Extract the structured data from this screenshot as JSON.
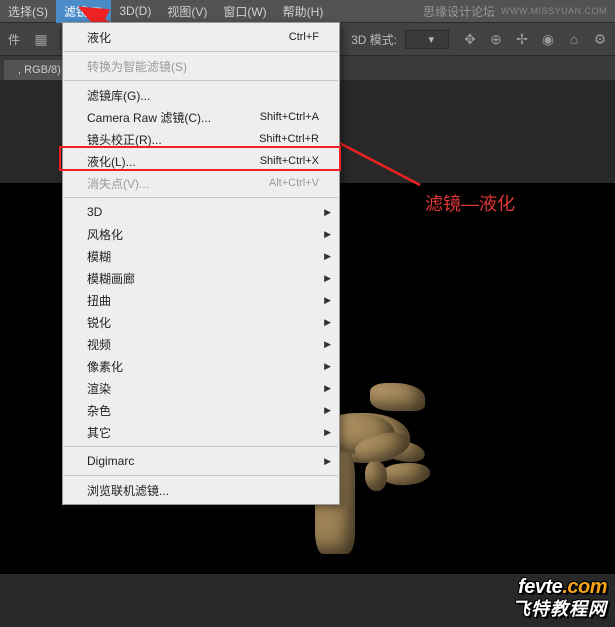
{
  "menubar": {
    "items": [
      {
        "label": "选择(S)"
      },
      {
        "label": "滤镜(T)"
      },
      {
        "label": "3D(D)"
      },
      {
        "label": "视图(V)"
      },
      {
        "label": "窗口(W)"
      },
      {
        "label": "帮助(H)"
      }
    ],
    "right_text": "思缘设计论坛",
    "url_text": "WWW.MISSYUAN.COM"
  },
  "toolbar": {
    "left_label": "件",
    "mode_label": "3D 模式:",
    "icons": {
      "i1": "grid-icon",
      "i2": "align-icon",
      "i3": "contain-icon",
      "i4": "overlap-icon",
      "i5": "list-icon",
      "r1": "orbit-icon",
      "r2": "pan-icon",
      "r3": "move-icon",
      "r4": "look-icon",
      "r5": "home-icon",
      "r6": "gear-icon"
    }
  },
  "tabbar": {
    "doc_label": ", RGB/8) *"
  },
  "annotation": {
    "text": "滤镜—液化"
  },
  "dropdown": {
    "liquify_top": {
      "label": "液化",
      "shortcut": "Ctrl+F"
    },
    "convert_smart": {
      "label": "转换为智能滤镜(S)"
    },
    "filter_gallery": {
      "label": "滤镜库(G)..."
    },
    "camera_raw": {
      "label": "Camera Raw 滤镜(C)...",
      "shortcut": "Shift+Ctrl+A"
    },
    "lens_correction": {
      "label": "镜头校正(R)...",
      "shortcut": "Shift+Ctrl+R"
    },
    "liquify": {
      "label": "液化(L)...",
      "shortcut": "Shift+Ctrl+X"
    },
    "vanishing_point": {
      "label": "消失点(V)...",
      "shortcut": "Alt+Ctrl+V"
    },
    "three_d": {
      "label": "3D"
    },
    "stylize": {
      "label": "风格化"
    },
    "blur": {
      "label": "模糊"
    },
    "blur_gallery": {
      "label": "模糊画廊"
    },
    "distort": {
      "label": "扭曲"
    },
    "sharpen": {
      "label": "锐化"
    },
    "video": {
      "label": "视频"
    },
    "pixelate": {
      "label": "像素化"
    },
    "render": {
      "label": "渲染"
    },
    "noise": {
      "label": "杂色"
    },
    "other": {
      "label": "其它"
    },
    "digimarc": {
      "label": "Digimarc"
    },
    "browse_online": {
      "label": "浏览联机滤镜..."
    }
  },
  "watermark": {
    "line1a": "fevte",
    "line1b": ".com",
    "line2": "飞特教程网"
  }
}
